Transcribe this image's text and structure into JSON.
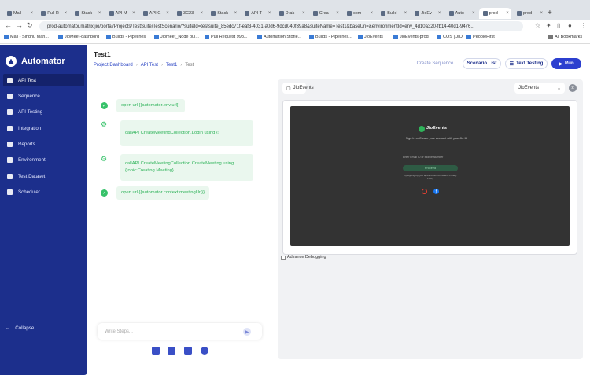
{
  "browser": {
    "tabs": [
      "Mail",
      "Pull R",
      "Stack",
      "API M",
      "API G",
      "3C23",
      "Stack",
      "API T",
      "Drak",
      "Crea",
      "com",
      "Build",
      "JioEv",
      "Auto",
      "prod",
      "prod"
    ],
    "active_tab_index": 14,
    "url": "prod-automator.matrix.jio/portal/Projects/TestSuite/TestScenario/?suiteId=testsuite_85edc71f-eaf3-4031-a0d6-9dcd040f39a8&suiteName=Test1&baseUri=&environmentId=env_4d10a320-fb14-40d1-9476...",
    "bookmarks": [
      "Mail - Sindhu Man...",
      "JioMeet-dashbord",
      "Builds - Pipelines",
      "Jiomeet_Node pul...",
      "Pull Request 998...",
      "Automation Storie...",
      "Builds - Pipelines...",
      "JioEvents",
      "JioEvents-prod",
      "COS | JIO",
      "PeopleFirst"
    ],
    "all_bookmarks": "All Bookmarks"
  },
  "sidebar": {
    "app_name": "Automator",
    "items": [
      {
        "label": "API Test",
        "icon": "video-icon"
      },
      {
        "label": "Sequence",
        "icon": "list-icon"
      },
      {
        "label": "API Testing",
        "icon": "api-icon"
      },
      {
        "label": "Integration",
        "icon": "plug-icon"
      },
      {
        "label": "Reports",
        "icon": "report-icon"
      },
      {
        "label": "Environment",
        "icon": "gear-icon"
      },
      {
        "label": "Test Dataset",
        "icon": "dataset-icon"
      },
      {
        "label": "Scheduler",
        "icon": "scheduler-icon"
      }
    ],
    "active_index": 0,
    "collapse_label": "Collapse"
  },
  "header": {
    "title": "Test1",
    "breadcrumb": [
      "Project Dashboard",
      "API Test",
      "Test1",
      "Test"
    ],
    "create_sequence": "Create Sequence",
    "scenario_list": "Scenario List",
    "text_testing": "Text Testing",
    "run": "Run"
  },
  "steps": [
    {
      "text": "open url {{automator.env.url}}",
      "status": "check"
    },
    {
      "text": "callAPI CreateMeetingCollection.Login using {}",
      "status": "gear"
    },
    {
      "text": "callAPI CreateMeetingCollection.CreateMeeting using {topic:Creating Meeting}",
      "status": "gear"
    },
    {
      "text": "open url {{automator.context.meetingUrl}}",
      "status": "check"
    }
  ],
  "composer": {
    "placeholder": "Write Steps..."
  },
  "preview": {
    "tab_label": "JioEvents",
    "env_select": "JioEvents",
    "jio_title": "JioEvents",
    "jio_subtitle": "Sign In or Create your account with your Jio ID",
    "jio_input_placeholder": "Enter Email ID or Mobile Number",
    "jio_button": "Proceed",
    "jio_terms": "By signing up, you agree to our Terms and Privacy Policy",
    "advance_debugging": "Advance Debugging"
  },
  "colors": {
    "sidebar": "#1c2f8c",
    "accent": "#2c3fcf",
    "step_green": "#2fb35a"
  }
}
